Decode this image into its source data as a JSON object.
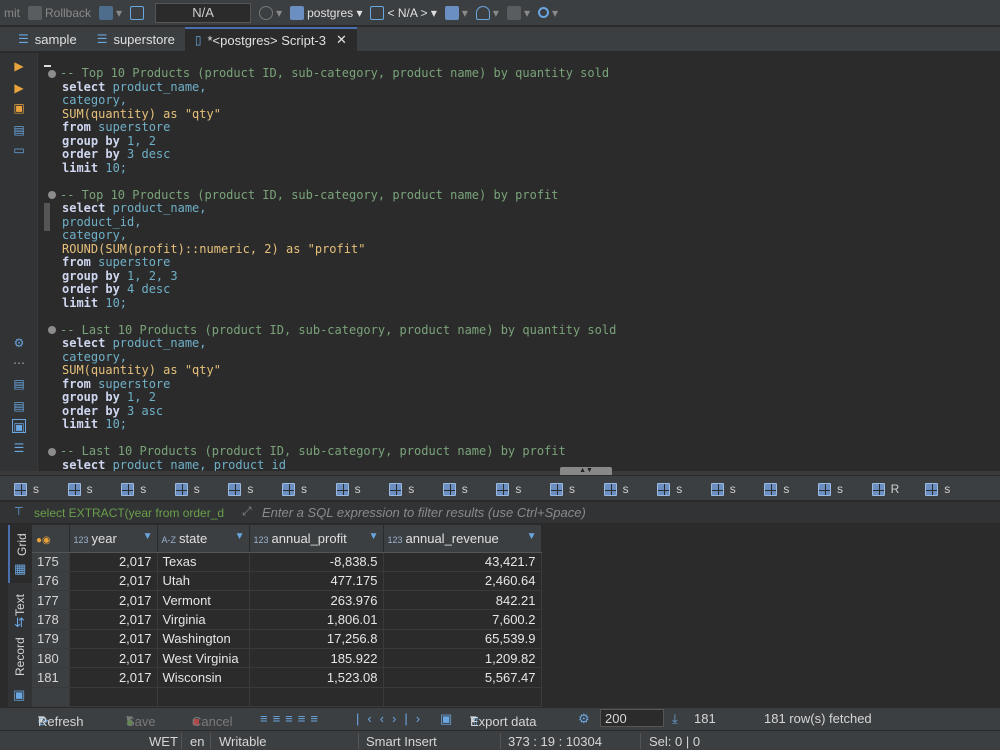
{
  "toolbar": {
    "commit_label": "mit",
    "rollback_label": "Rollback",
    "connection_value": "N/A",
    "database_label": "postgres",
    "schema_label": "< N/A >"
  },
  "editor_tabs": [
    {
      "label": "sample"
    },
    {
      "label": "superstore"
    },
    {
      "label": "*<postgres> Script-3"
    }
  ],
  "code_lines": [
    [
      "cm",
      "-- Top 10 Products (product ID, sub-category, product name) by quantity sold"
    ],
    [
      "kw",
      "select",
      " product_name,"
    ],
    [
      "id",
      "category,"
    ],
    [
      "fn",
      "SUM(quantity) as \"qty\""
    ],
    [
      "kw",
      "from",
      " superstore"
    ],
    [
      "kw",
      "group by",
      " 1, 2"
    ],
    [
      "kw",
      "order by",
      " 3 desc"
    ],
    [
      "kw",
      "limit",
      " 10;"
    ],
    [
      "pl",
      ""
    ],
    [
      "cm",
      "-- Top 10 Products (product ID, sub-category, product name) by profit"
    ],
    [
      "kw",
      "select",
      " product_name,"
    ],
    [
      "id",
      "product_id,"
    ],
    [
      "id",
      "category,"
    ],
    [
      "fn",
      "ROUND(SUM(profit)::numeric, 2) as \"profit\""
    ],
    [
      "kw",
      "from",
      " superstore"
    ],
    [
      "kw",
      "group by",
      " 1, 2, 3"
    ],
    [
      "kw",
      "order by",
      " 4 desc"
    ],
    [
      "kw",
      "limit",
      " 10;"
    ],
    [
      "pl",
      ""
    ],
    [
      "cm",
      "-- Last 10 Products (product ID, sub-category, product name) by quantity sold"
    ],
    [
      "kw",
      "select",
      " product_name,"
    ],
    [
      "id",
      "category,"
    ],
    [
      "fn",
      "SUM(quantity) as \"qty\""
    ],
    [
      "kw",
      "from",
      " superstore"
    ],
    [
      "kw",
      "group by",
      " 1, 2"
    ],
    [
      "kw",
      "order by",
      " 3 asc"
    ],
    [
      "kw",
      "limit",
      " 10;"
    ],
    [
      "pl",
      ""
    ],
    [
      "cm",
      "-- Last 10 Products (product ID, sub-category, product name) by profit"
    ],
    [
      "kw",
      "select",
      " product_name, product_id"
    ]
  ],
  "result_tabs": [
    "s",
    "s",
    "s",
    "s",
    "s",
    "s",
    "s",
    "s",
    "s",
    "s",
    "s",
    "s",
    "s",
    "s",
    "s",
    "s",
    "R",
    "s"
  ],
  "filter": {
    "query_preview": "select EXTRACT(year from order_d",
    "placeholder": "Enter a SQL expression to filter results (use Ctrl+Space)"
  },
  "side_tabs": [
    "Grid",
    "Text",
    "Record"
  ],
  "grid": {
    "columns": [
      {
        "type": "123",
        "name": "year"
      },
      {
        "type": "A-Z",
        "name": "state"
      },
      {
        "type": "123",
        "name": "annual_profit"
      },
      {
        "type": "123",
        "name": "annual_revenue"
      }
    ],
    "rows": [
      [
        "175",
        "2,017",
        "Texas",
        "-8,838.5",
        "43,421.7"
      ],
      [
        "176",
        "2,017",
        "Utah",
        "477.175",
        "2,460.64"
      ],
      [
        "177",
        "2,017",
        "Vermont",
        "263.976",
        "842.21"
      ],
      [
        "178",
        "2,017",
        "Virginia",
        "1,806.01",
        "7,600.2"
      ],
      [
        "179",
        "2,017",
        "Washington",
        "17,256.8",
        "65,539.9"
      ],
      [
        "180",
        "2,017",
        "West Virginia",
        "185.922",
        "1,209.82"
      ],
      [
        "181",
        "2,017",
        "Wisconsin",
        "1,523.08",
        "5,567.47"
      ]
    ]
  },
  "bottom_toolbar": {
    "refresh": "Refresh",
    "save": "Save",
    "cancel": "Cancel",
    "export": "Export data",
    "fetch_size": "200",
    "row_count": "181",
    "fetched": "181 row(s) fetched"
  },
  "status": {
    "timezone": "WET",
    "locale": "en",
    "mode": "Writable",
    "insert": "Smart Insert",
    "position": "373 : 19 : 10304",
    "selection": "Sel: 0 | 0"
  }
}
